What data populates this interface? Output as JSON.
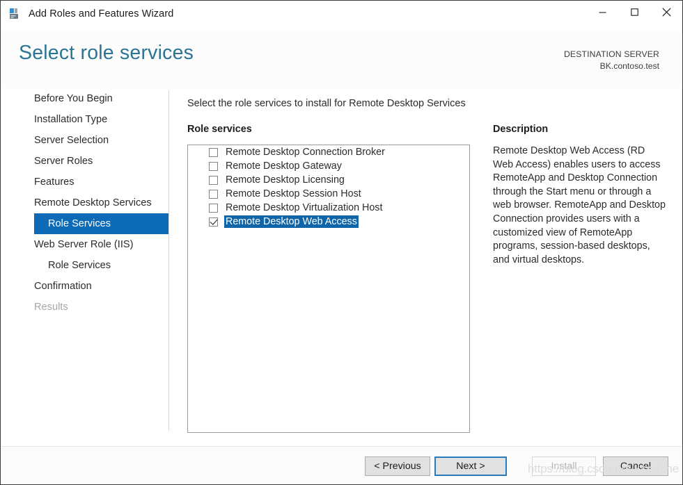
{
  "window": {
    "title": "Add Roles and Features Wizard",
    "app_icon": "server-roles-icon",
    "minimize_label": "Minimize",
    "maximize_label": "Maximize",
    "close_label": "Close"
  },
  "header": {
    "page_title": "Select role services",
    "destination_label": "DESTINATION SERVER",
    "destination_value": "BK.contoso.test",
    "title_color": "#2c7493"
  },
  "sidebar": {
    "items": [
      {
        "label": "Before You Begin",
        "state": "normal",
        "indent": 0
      },
      {
        "label": "Installation Type",
        "state": "normal",
        "indent": 0
      },
      {
        "label": "Server Selection",
        "state": "normal",
        "indent": 0
      },
      {
        "label": "Server Roles",
        "state": "normal",
        "indent": 0
      },
      {
        "label": "Features",
        "state": "normal",
        "indent": 0
      },
      {
        "label": "Remote Desktop Services",
        "state": "normal",
        "indent": 0
      },
      {
        "label": "Role Services",
        "state": "selected",
        "indent": 1
      },
      {
        "label": "Web Server Role (IIS)",
        "state": "normal",
        "indent": 0
      },
      {
        "label": "Role Services",
        "state": "normal",
        "indent": 1
      },
      {
        "label": "Confirmation",
        "state": "normal",
        "indent": 0
      },
      {
        "label": "Results",
        "state": "disabled",
        "indent": 0
      }
    ],
    "selected_color": "#0c6ab7"
  },
  "main": {
    "instruction": "Select the role services to install for Remote Desktop Services",
    "role_services_label": "Role services",
    "description_label": "Description",
    "role_services": [
      {
        "label": "Remote Desktop Connection Broker",
        "checked": false,
        "selected": false
      },
      {
        "label": "Remote Desktop Gateway",
        "checked": false,
        "selected": false
      },
      {
        "label": "Remote Desktop Licensing",
        "checked": false,
        "selected": false
      },
      {
        "label": "Remote Desktop Session Host",
        "checked": false,
        "selected": false
      },
      {
        "label": "Remote Desktop Virtualization Host",
        "checked": false,
        "selected": false
      },
      {
        "label": "Remote Desktop Web Access",
        "checked": true,
        "selected": true
      }
    ],
    "selection_color": "#1065a8",
    "description_text": "Remote Desktop Web Access (RD Web Access) enables users to access RemoteApp and Desktop Connection through the Start menu or through a web browser. RemoteApp and Desktop Connection provides users with a customized view of RemoteApp programs, session-based desktops, and virtual desktops."
  },
  "footer": {
    "previous_label": "< Previous",
    "next_label": "Next >",
    "install_label": "Install",
    "cancel_label": "Cancel",
    "install_enabled": false
  },
  "watermark": {
    "text": "https://blog.csdn.net/xxxshine"
  }
}
